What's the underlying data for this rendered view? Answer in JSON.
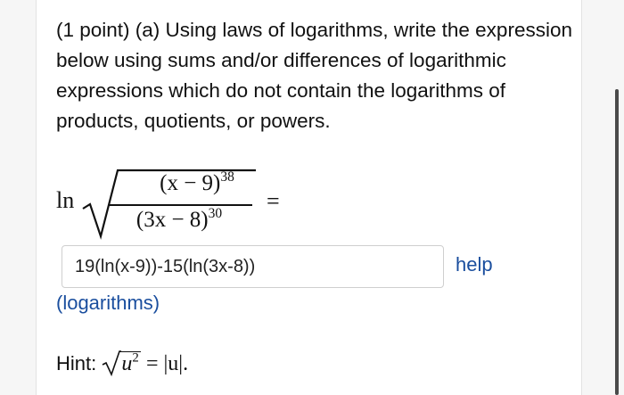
{
  "question": {
    "text": "(1 point) (a) Using laws of logarithms, write the expression below using sums and/or differences of logarithmic expressions which do not contain the logarithms of products, quotients, or powers."
  },
  "expression": {
    "ln": "ln",
    "numerator_base": "(x − 9)",
    "numerator_exp": "38",
    "denominator_base": "(3x − 8)",
    "denominator_exp": "30",
    "equals": "="
  },
  "answer": {
    "value": "19(ln(x-9))-15(ln(3x-8))",
    "placeholder": ""
  },
  "links": {
    "help": "help",
    "topic": "(logarithms)"
  },
  "hint": {
    "label": "Hint:",
    "radicand_base": "u",
    "radicand_exp": "2",
    "rhs": "= |u|."
  },
  "colors": {
    "link": "#1a4e9e",
    "text": "#111111",
    "input_border": "#cfcfcf"
  }
}
